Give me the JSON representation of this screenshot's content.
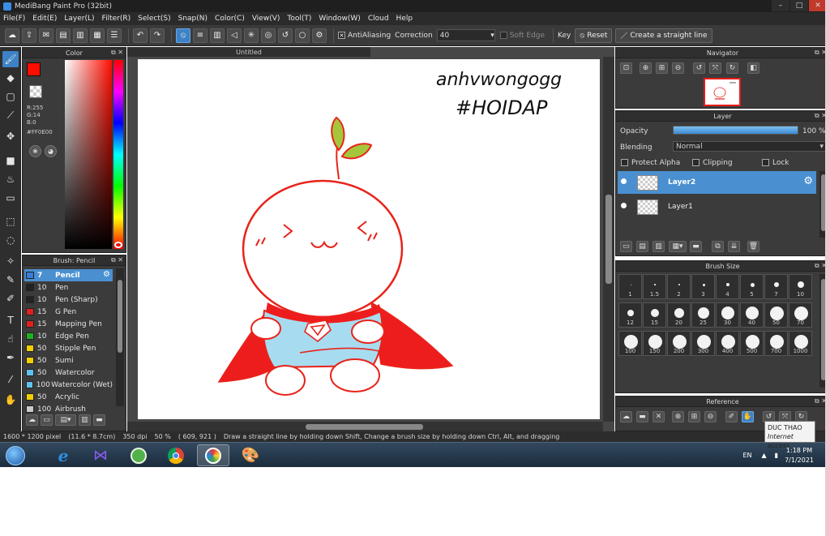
{
  "window": {
    "title": "MediBang Paint Pro (32bit)",
    "controls": [
      "–",
      "□",
      "✕"
    ]
  },
  "menu": [
    "File(F)",
    "Edit(E)",
    "Layer(L)",
    "Filter(R)",
    "Select(S)",
    "Snap(N)",
    "Color(C)",
    "View(V)",
    "Tool(T)",
    "Window(W)",
    "Cloud",
    "Help"
  ],
  "toolbar": {
    "antialiasing_label": "AntiAliasing",
    "antialiasing_checked": true,
    "correction_label": "Correction",
    "correction_value": "40",
    "soft_edge_label": "Soft Edge",
    "key_label": "Key",
    "reset_label": "Reset",
    "straight_line_label": "Create a straight line"
  },
  "color_panel": {
    "title": "Color",
    "r": "R:255",
    "g": "G:14",
    "b": "B:0",
    "hex": "#FF0E00",
    "current_color": "#ff0e00"
  },
  "brush_panel": {
    "title": "Brush: Pencil",
    "brushes": [
      {
        "size": "7",
        "name": "Pencil",
        "color": "#3a7bd5",
        "selected": true
      },
      {
        "size": "10",
        "name": "Pen",
        "color": "#222222"
      },
      {
        "size": "10",
        "name": "Pen (Sharp)",
        "color": "#222222"
      },
      {
        "size": "15",
        "name": "G Pen",
        "color": "#e02020"
      },
      {
        "size": "15",
        "name": "Mapping Pen",
        "color": "#e02020"
      },
      {
        "size": "10",
        "name": "Edge Pen",
        "color": "#20b020"
      },
      {
        "size": "50",
        "name": "Stipple Pen",
        "color": "#f0d000"
      },
      {
        "size": "50",
        "name": "Sumi",
        "color": "#f0d000"
      },
      {
        "size": "50",
        "name": "Watercolor",
        "color": "#60c0f0"
      },
      {
        "size": "100",
        "name": "Watercolor (Wet)",
        "color": "#60c0f0"
      },
      {
        "size": "50",
        "name": "Acrylic",
        "color": "#f0d000"
      },
      {
        "size": "100",
        "name": "Airbrush",
        "color": "#cccccc"
      }
    ]
  },
  "canvas": {
    "tab_title": "Untitled",
    "handwriting_line1": "anhvwongogg",
    "handwriting_line2": "#HOIDAP"
  },
  "navigator": {
    "title": "Navigator"
  },
  "layer_panel": {
    "title": "Layer",
    "opacity_label": "Opacity",
    "opacity_value": "100 %",
    "opacity_fraction": 1.0,
    "blending_label": "Blending",
    "blending_value": "Normal",
    "protect_alpha_label": "Protect Alpha",
    "clipping_label": "Clipping",
    "lock_label": "Lock",
    "layers": [
      {
        "name": "Layer2",
        "selected": true
      },
      {
        "name": "Layer1",
        "selected": false
      }
    ]
  },
  "brush_size_panel": {
    "title": "Brush Size",
    "sizes": [
      "1",
      "1.5",
      "2",
      "3",
      "4",
      "5",
      "7",
      "10",
      "12",
      "15",
      "20",
      "25",
      "30",
      "40",
      "50",
      "70",
      "100",
      "150",
      "200",
      "300",
      "400",
      "500",
      "700",
      "1000"
    ]
  },
  "reference_panel": {
    "title": "Reference"
  },
  "status": {
    "dimensions": "1600 * 1200 pixel",
    "physical": "(11.6 * 8.7cm)",
    "dpi": "350 dpi",
    "zoom": "50 %",
    "cursor": "( 609, 921 )",
    "hint": "Draw a straight line by holding down Shift, Change a brush size by holding down Ctrl, Alt, and dragging"
  },
  "taskbar": {
    "lang": "EN",
    "time": "1:18 PM",
    "date": "7/1/2021",
    "tooltip_title": "DUC THAO",
    "tooltip_body": "Internet access"
  },
  "colors": {
    "accent": "#3d82c7",
    "ink": "#e8231a",
    "shirt": "#a7dcf0",
    "leaf": "#a5c63a"
  }
}
